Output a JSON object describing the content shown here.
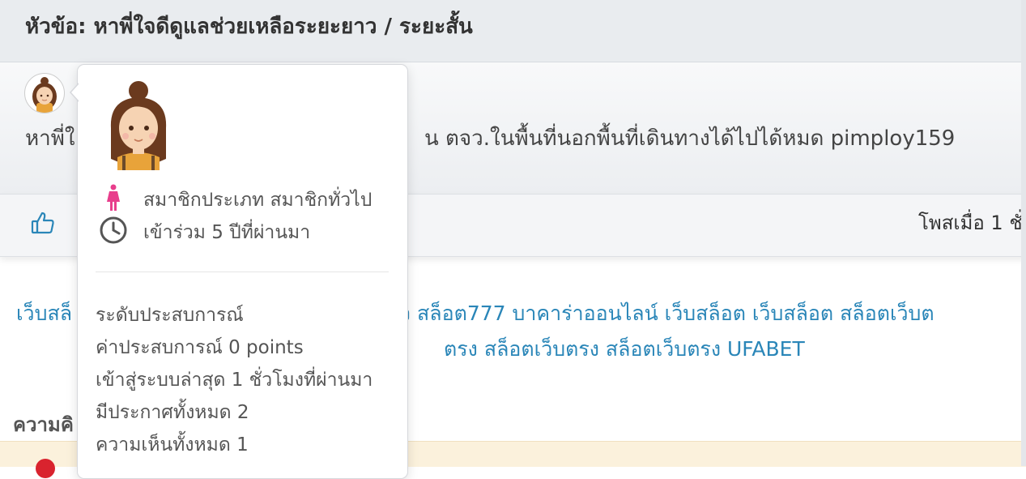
{
  "topic": {
    "title": "หัวข้อ: หาพี่ใจดีดูแลช่วยเหลือระยะยาว / ระยะสั้น"
  },
  "post": {
    "text_lead": "หาพี่ใ",
    "text_tail": "น ตจว.ในพื้นที่นอกพื้นที่เดินทางได้ไปได้หมด pimploy159",
    "posted_at": "โพสเมื่อ 1 ชั่"
  },
  "links": {
    "line1_lead": "เว็บสล็",
    "line1_tail": "ว สล็อต777 บาคาร่าออนไลน์ เว็บสล็อต เว็บสล็อต สล็อตเว็บต",
    "line2_tail": "ตรง สล็อตเว็บตรง สล็อตเว็บตรง UFABET"
  },
  "comments": {
    "heading": "ความคิ"
  },
  "profile": {
    "member_type": "สมาชิกประเภท สมาชิกทั่วไป",
    "joined": "เข้าร่วม 5 ปีที่ผ่านมา",
    "experience_level": "ระดับประสบการณ์",
    "experience_points": "ค่าประสบการณ์ 0 points",
    "last_login": "เข้าสู่ระบบล่าสุด 1 ชั่วโมงที่ผ่านมา",
    "total_posts": "มีประกาศทั้งหมด 2",
    "total_comments": "ความเห็นทั้งหมด 1"
  },
  "icons": {
    "gender": "female-icon",
    "clock": "clock-icon",
    "like": "thumbs-up-icon"
  },
  "colors": {
    "link": "#2a86b8",
    "like": "#2a86b8",
    "female": "#e83e8c",
    "alert_bg": "#fbf1dc",
    "alert_icon": "#d9232e"
  }
}
